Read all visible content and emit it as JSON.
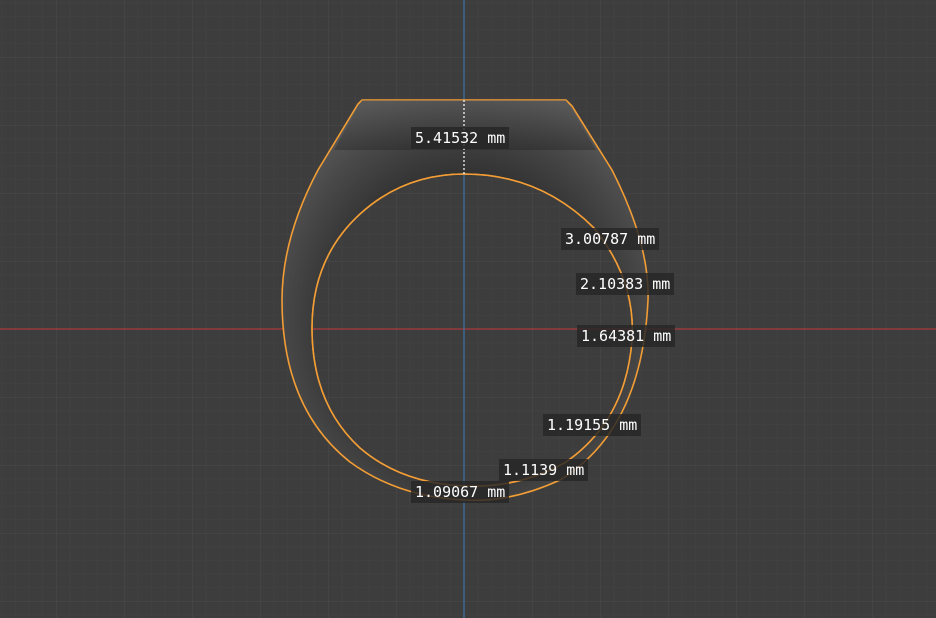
{
  "viewport": {
    "name": "3D viewport - front orthographic",
    "colors": {
      "background": "#3d3d3d",
      "grid_minor": "#434343",
      "grid_major": "#4a4a4a",
      "x_axis": "#c23a3a",
      "z_axis": "#3d7fb8",
      "selection_outline": "#f29d35",
      "label_bg": "#262626",
      "label_text": "#ffffff"
    }
  },
  "object": {
    "name": "ring",
    "selected": true
  },
  "measurements": [
    {
      "id": "m1",
      "text": "5.41532 mm"
    },
    {
      "id": "m2",
      "text": "3.00787 mm"
    },
    {
      "id": "m3",
      "text": "2.10383 mm"
    },
    {
      "id": "m4",
      "text": "1.64381 mm"
    },
    {
      "id": "m5",
      "text": "1.19155 mm"
    },
    {
      "id": "m6",
      "text": "1.1139 mm"
    },
    {
      "id": "m7",
      "text": "1.09067 mm"
    }
  ]
}
